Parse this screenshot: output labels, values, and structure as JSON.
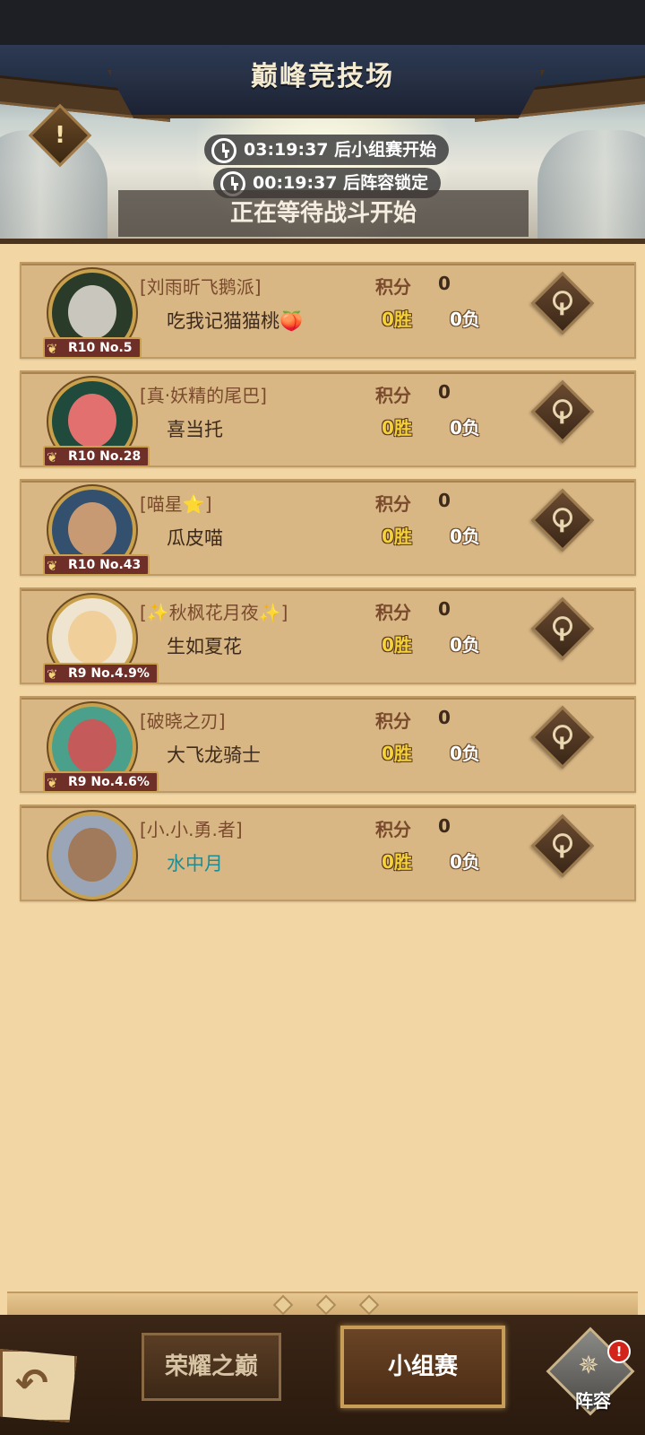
{
  "header": {
    "title": "巅峰竞技场",
    "warning_symbol": "!",
    "timer1": "03:19:37 后小组赛开始",
    "timer2": "00:19:37 后阵容锁定",
    "waiting_text": "正在等待战斗开始"
  },
  "labels": {
    "score": "积分",
    "inspect_icon": "magnifier-icon"
  },
  "players": [
    {
      "guild": "[刘雨昕飞鹅派]",
      "name": "吃我记猫猫桃🍑",
      "rank": "R10 No.5",
      "score": "0",
      "wins": "0胜",
      "losses": "0负",
      "avatar_color": "#2b3b2a",
      "face_color": "#c9c6bd"
    },
    {
      "guild": "[真·妖精的尾巴]",
      "name": "喜当托",
      "rank": "R10 No.28",
      "score": "0",
      "wins": "0胜",
      "losses": "0负",
      "avatar_color": "#1f4a3c",
      "face_color": "#e2706e"
    },
    {
      "guild": "[喵星⭐]",
      "name": "瓜皮喵",
      "rank": "R10 No.43",
      "score": "0",
      "wins": "0胜",
      "losses": "0负",
      "avatar_color": "#33506e",
      "face_color": "#c89a74"
    },
    {
      "guild": "[✨秋枫花月夜✨]",
      "name": "生如夏花",
      "rank": "R9 No.4.9%",
      "score": "0",
      "wins": "0胜",
      "losses": "0负",
      "avatar_color": "#efe4cf",
      "face_color": "#f0cf9a"
    },
    {
      "guild": "[破晓之刃]",
      "name": "大飞龙骑士",
      "rank": "R9 No.4.6%",
      "score": "0",
      "wins": "0胜",
      "losses": "0负",
      "avatar_color": "#4aa08a",
      "face_color": "#c45a5a"
    },
    {
      "guild": "[小.小.勇.者]",
      "name": "水中月",
      "rank": "",
      "score": "0",
      "wins": "0胜",
      "losses": "0负",
      "avatar_color": "#9aa6b8",
      "face_color": "#a07a5a",
      "name_color": "cyan"
    }
  ],
  "bottom": {
    "back_symbol": "↶",
    "tab1": "荣耀之巅",
    "tab2": "小组赛",
    "lineup_label": "阵容",
    "lineup_symbol": "✵",
    "alert": "!"
  }
}
